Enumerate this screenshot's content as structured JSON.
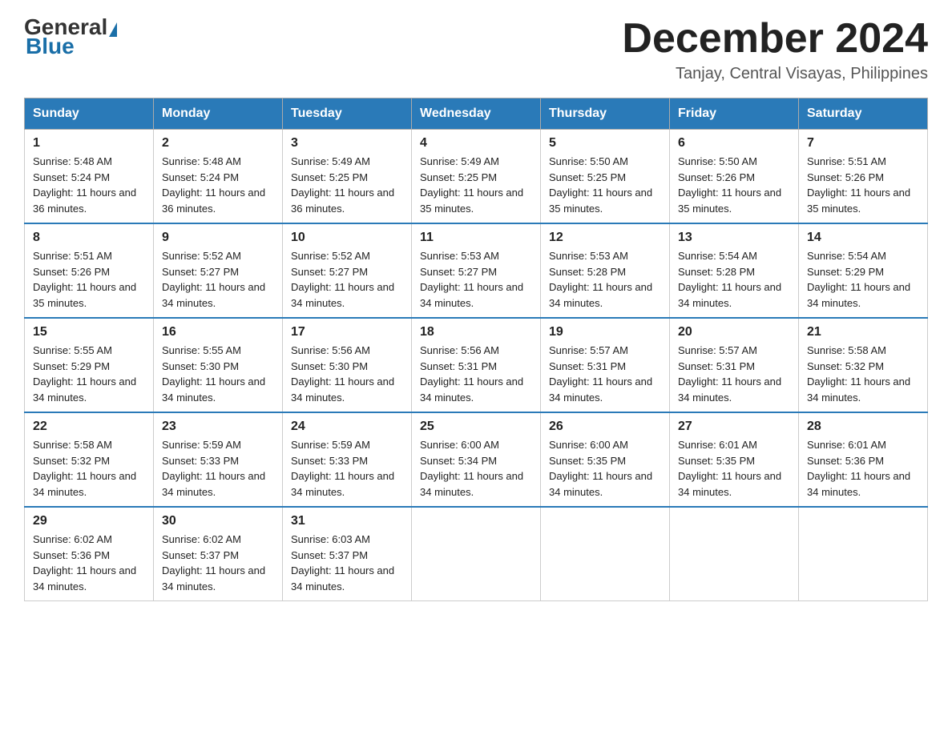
{
  "header": {
    "logo_general": "General",
    "logo_blue": "Blue",
    "month_title": "December 2024",
    "location": "Tanjay, Central Visayas, Philippines"
  },
  "days_of_week": [
    "Sunday",
    "Monday",
    "Tuesday",
    "Wednesday",
    "Thursday",
    "Friday",
    "Saturday"
  ],
  "weeks": [
    [
      {
        "day": "1",
        "sunrise": "5:48 AM",
        "sunset": "5:24 PM",
        "daylight": "11 hours and 36 minutes."
      },
      {
        "day": "2",
        "sunrise": "5:48 AM",
        "sunset": "5:24 PM",
        "daylight": "11 hours and 36 minutes."
      },
      {
        "day": "3",
        "sunrise": "5:49 AM",
        "sunset": "5:25 PM",
        "daylight": "11 hours and 36 minutes."
      },
      {
        "day": "4",
        "sunrise": "5:49 AM",
        "sunset": "5:25 PM",
        "daylight": "11 hours and 35 minutes."
      },
      {
        "day": "5",
        "sunrise": "5:50 AM",
        "sunset": "5:25 PM",
        "daylight": "11 hours and 35 minutes."
      },
      {
        "day": "6",
        "sunrise": "5:50 AM",
        "sunset": "5:26 PM",
        "daylight": "11 hours and 35 minutes."
      },
      {
        "day": "7",
        "sunrise": "5:51 AM",
        "sunset": "5:26 PM",
        "daylight": "11 hours and 35 minutes."
      }
    ],
    [
      {
        "day": "8",
        "sunrise": "5:51 AM",
        "sunset": "5:26 PM",
        "daylight": "11 hours and 35 minutes."
      },
      {
        "day": "9",
        "sunrise": "5:52 AM",
        "sunset": "5:27 PM",
        "daylight": "11 hours and 34 minutes."
      },
      {
        "day": "10",
        "sunrise": "5:52 AM",
        "sunset": "5:27 PM",
        "daylight": "11 hours and 34 minutes."
      },
      {
        "day": "11",
        "sunrise": "5:53 AM",
        "sunset": "5:27 PM",
        "daylight": "11 hours and 34 minutes."
      },
      {
        "day": "12",
        "sunrise": "5:53 AM",
        "sunset": "5:28 PM",
        "daylight": "11 hours and 34 minutes."
      },
      {
        "day": "13",
        "sunrise": "5:54 AM",
        "sunset": "5:28 PM",
        "daylight": "11 hours and 34 minutes."
      },
      {
        "day": "14",
        "sunrise": "5:54 AM",
        "sunset": "5:29 PM",
        "daylight": "11 hours and 34 minutes."
      }
    ],
    [
      {
        "day": "15",
        "sunrise": "5:55 AM",
        "sunset": "5:29 PM",
        "daylight": "11 hours and 34 minutes."
      },
      {
        "day": "16",
        "sunrise": "5:55 AM",
        "sunset": "5:30 PM",
        "daylight": "11 hours and 34 minutes."
      },
      {
        "day": "17",
        "sunrise": "5:56 AM",
        "sunset": "5:30 PM",
        "daylight": "11 hours and 34 minutes."
      },
      {
        "day": "18",
        "sunrise": "5:56 AM",
        "sunset": "5:31 PM",
        "daylight": "11 hours and 34 minutes."
      },
      {
        "day": "19",
        "sunrise": "5:57 AM",
        "sunset": "5:31 PM",
        "daylight": "11 hours and 34 minutes."
      },
      {
        "day": "20",
        "sunrise": "5:57 AM",
        "sunset": "5:31 PM",
        "daylight": "11 hours and 34 minutes."
      },
      {
        "day": "21",
        "sunrise": "5:58 AM",
        "sunset": "5:32 PM",
        "daylight": "11 hours and 34 minutes."
      }
    ],
    [
      {
        "day": "22",
        "sunrise": "5:58 AM",
        "sunset": "5:32 PM",
        "daylight": "11 hours and 34 minutes."
      },
      {
        "day": "23",
        "sunrise": "5:59 AM",
        "sunset": "5:33 PM",
        "daylight": "11 hours and 34 minutes."
      },
      {
        "day": "24",
        "sunrise": "5:59 AM",
        "sunset": "5:33 PM",
        "daylight": "11 hours and 34 minutes."
      },
      {
        "day": "25",
        "sunrise": "6:00 AM",
        "sunset": "5:34 PM",
        "daylight": "11 hours and 34 minutes."
      },
      {
        "day": "26",
        "sunrise": "6:00 AM",
        "sunset": "5:35 PM",
        "daylight": "11 hours and 34 minutes."
      },
      {
        "day": "27",
        "sunrise": "6:01 AM",
        "sunset": "5:35 PM",
        "daylight": "11 hours and 34 minutes."
      },
      {
        "day": "28",
        "sunrise": "6:01 AM",
        "sunset": "5:36 PM",
        "daylight": "11 hours and 34 minutes."
      }
    ],
    [
      {
        "day": "29",
        "sunrise": "6:02 AM",
        "sunset": "5:36 PM",
        "daylight": "11 hours and 34 minutes."
      },
      {
        "day": "30",
        "sunrise": "6:02 AM",
        "sunset": "5:37 PM",
        "daylight": "11 hours and 34 minutes."
      },
      {
        "day": "31",
        "sunrise": "6:03 AM",
        "sunset": "5:37 PM",
        "daylight": "11 hours and 34 minutes."
      },
      null,
      null,
      null,
      null
    ]
  ],
  "labels": {
    "sunrise": "Sunrise:",
    "sunset": "Sunset:",
    "daylight": "Daylight:"
  }
}
